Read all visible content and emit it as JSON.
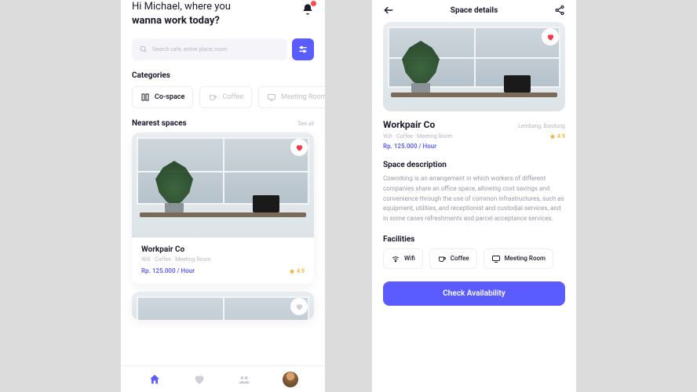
{
  "screen1": {
    "greeting_line1": "Hi Michael, where you",
    "greeting_line2": "wanna work today?",
    "search_placeholder": "Search cafe, entire place, room",
    "categories_title": "Categories",
    "categories": [
      {
        "label": "Co-space",
        "icon": "co-space-icon"
      },
      {
        "label": "Coffee",
        "icon": "coffee-icon"
      },
      {
        "label": "Meeting Room",
        "icon": "meeting-room-icon"
      }
    ],
    "nearest_title": "Nearest spaces",
    "see_all": "See all",
    "card": {
      "title": "Workpair Co",
      "subtitle": "Wifi · Coffee · Meeting Room",
      "price": "Rp. 125.000 / Hour",
      "rating": "4.9"
    }
  },
  "screen2": {
    "header_title": "Space details",
    "name": "Workpair Co",
    "location": "Lembang, Bandung",
    "subtitle": "Wifi · Coffee · Meeting Room",
    "rating": "4.9",
    "price": "Rp. 125.000 / Hour",
    "desc_title": "Space description",
    "desc_text": "Coworking is an arrangement in which workers of different companies share an office space, allowing cost savings and convenience through the use of common infrastructures, such as equipment, utilities, and receptionist and custodial services, and in some cases refreshments and parcel acceptance services.",
    "facilities_title": "Facilities",
    "facilities": [
      {
        "label": "Wifi"
      },
      {
        "label": "Coffee"
      },
      {
        "label": "Meeting Room"
      }
    ],
    "cta": "Check Availability"
  },
  "colors": {
    "primary": "#5a5cff",
    "heart": "#ff3344",
    "star": "#f2b236"
  }
}
